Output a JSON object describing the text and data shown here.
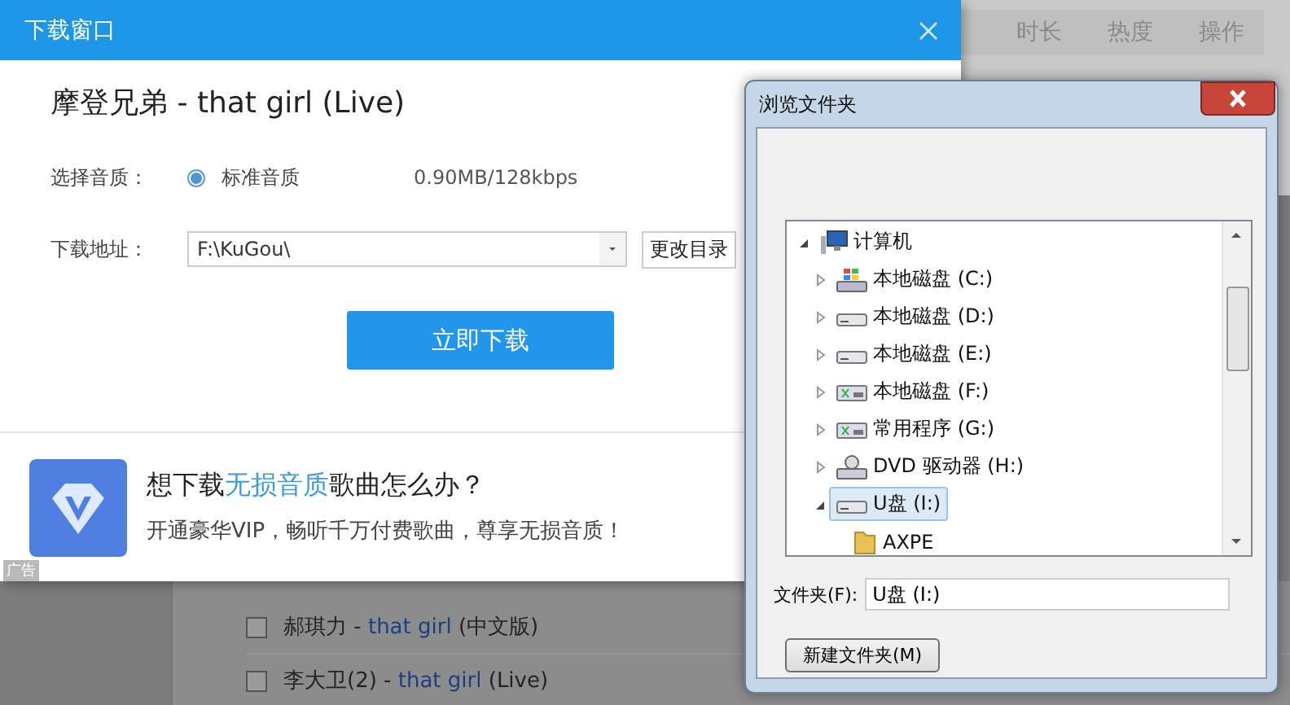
{
  "background_app": {
    "columns": [
      "时长",
      "热度",
      "操作"
    ],
    "tracks": [
      {
        "artist": "郝琪力 - ",
        "title": "that girl",
        "suffix": "(中文版)",
        "checked": false
      },
      {
        "artist": "李大卫(2) - ",
        "title": "that girl",
        "suffix": "(Live)",
        "checked": false
      }
    ]
  },
  "download_dialog": {
    "title": "下载窗口",
    "song": "摩登兄弟 - that girl (Live)",
    "quality_label": "选择音质：",
    "quality_options": [
      {
        "label": "标准音质",
        "info": "0.90MB/128kbps",
        "selected": true
      }
    ],
    "path_label": "下载地址：",
    "path_value": "F:\\KuGou\\",
    "change_dir_button": "更改目录",
    "download_button": "立即下载",
    "ad": {
      "headline": [
        {
          "text": "想下载",
          "highlight": false
        },
        {
          "text": "无损音质",
          "highlight": true
        },
        {
          "text": "歌曲怎么办？",
          "highlight": false
        }
      ],
      "subtitle": "开通豪华VIP，畅听千万付费歌曲，尊享无损音质！",
      "tag": "广告"
    }
  },
  "browse_dialog": {
    "title": "浏览文件夹",
    "tree": [
      {
        "label": "计算机",
        "kind": "computer",
        "expanded": true,
        "selected": false,
        "children": [
          {
            "label": "本地磁盘 (C:)",
            "kind": "system-drive",
            "expanded": false,
            "selected": false
          },
          {
            "label": "本地磁盘 (D:)",
            "kind": "drive",
            "expanded": false,
            "selected": false
          },
          {
            "label": "本地磁盘 (E:)",
            "kind": "drive",
            "expanded": false,
            "selected": false
          },
          {
            "label": "本地磁盘 (F:)",
            "kind": "network-drive",
            "expanded": false,
            "selected": false
          },
          {
            "label": "常用程序 (G:)",
            "kind": "network-drive",
            "expanded": false,
            "selected": false
          },
          {
            "label": "DVD 驱动器 (H:)",
            "kind": "dvd",
            "expanded": false,
            "selected": false
          },
          {
            "label": "U盘 (I:)",
            "kind": "drive",
            "expanded": true,
            "selected": true,
            "children": [
              {
                "label": "AXPE",
                "kind": "folder",
                "selected": false
              }
            ]
          }
        ]
      }
    ],
    "folder_label": "文件夹(F):",
    "folder_value": "U盘 (I:)",
    "new_folder_button": "新建文件夹(M)"
  }
}
